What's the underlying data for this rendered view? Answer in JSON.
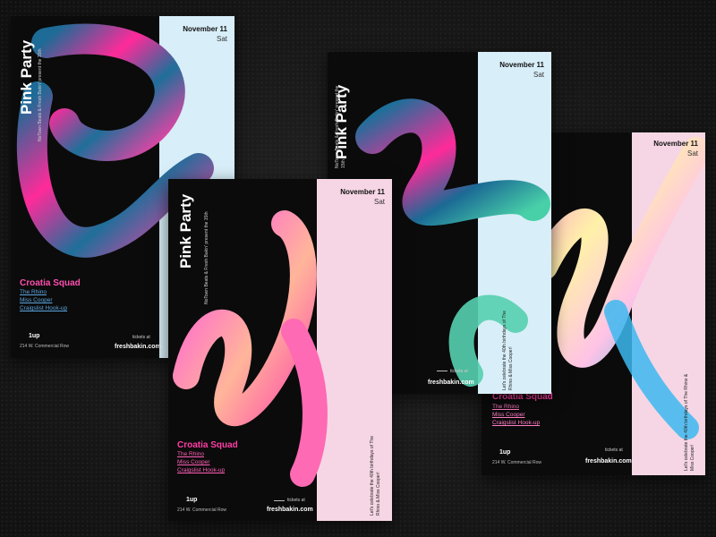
{
  "posters": [
    {
      "date": "November 11",
      "day": "Sat",
      "title": "Pink Party",
      "presenter": "NoTown Beats & Fresh Bakin' present the 15th",
      "headline": "Croatia Squad",
      "acts": [
        "The Rhino",
        "Miss Cooper",
        "Craigslist Hook-up"
      ],
      "venue": "1up",
      "address": "214 W. Commercial Row",
      "tickets_label": "tickets at",
      "url": "freshbakin.com"
    },
    {
      "date": "November 11",
      "day": "Sat",
      "title": "Pink Party",
      "presenter": "NoTown Beats & Fresh Bakin' present the 15th",
      "headline": "Croatia Squad",
      "acts": [
        "The Rhino",
        "Miss Cooper",
        "Craigslist Hook-up"
      ],
      "venue": "1up",
      "address": "214 W. Commercial Row",
      "tickets_label": "tickets at",
      "url": "freshbakin.com",
      "side_note": "Let's celebrate the 40th birthdays of The Rhino & Miss Cooper!"
    },
    {
      "date": "November 11",
      "day": "Sat",
      "title": "Pink Party",
      "presenter": "NoTown Beats & Fresh Bakin' present the 15th",
      "tickets_label": "tickets at",
      "url": "freshbakin.com",
      "side_note": "Let's celebrate the 40th birthdays of The Rhino & Miss Cooper!"
    },
    {
      "date": "November 11",
      "day": "Sat",
      "headline": "Croatia Squad",
      "acts": [
        "The Rhino",
        "Miss Cooper",
        "Craigslist Hook-up"
      ],
      "venue": "1up",
      "address": "214 W. Commercial Row",
      "tickets_label": "tickets at",
      "url": "freshbakin.com",
      "side_note": "Let's celebrate the 40th birthdays of The Rhino & Miss Cooper!"
    }
  ],
  "colors": {
    "accent_pink": "#ff3ea5",
    "accent_blue": "#2a7ba8",
    "strip_light_blue": "#d8eef8",
    "strip_light_pink": "#f6d6e4"
  }
}
